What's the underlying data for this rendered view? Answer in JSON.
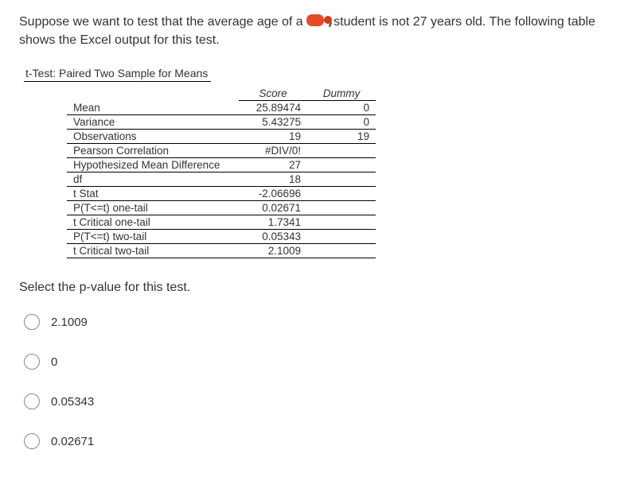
{
  "question": {
    "part1": "Suppose we want to test that the average age of a",
    "part2": "student is not 27 years old. The following table shows the Excel output for this test."
  },
  "table_title": "t-Test: Paired Two Sample for Means",
  "headers": {
    "col1": "Score",
    "col2": "Dummy"
  },
  "rows": [
    {
      "label": "Mean",
      "score": "25.89474",
      "dummy": "0"
    },
    {
      "label": "Variance",
      "score": "5.43275",
      "dummy": "0"
    },
    {
      "label": "Observations",
      "score": "19",
      "dummy": "19"
    },
    {
      "label": "Pearson Correlation",
      "score": "#DIV/0!",
      "dummy": ""
    },
    {
      "label": "Hypothesized Mean Difference",
      "score": "27",
      "dummy": ""
    },
    {
      "label": "df",
      "score": "18",
      "dummy": ""
    },
    {
      "label": "t Stat",
      "score": "-2.06696",
      "dummy": ""
    },
    {
      "label": "P(T<=t) one-tail",
      "score": "0.02671",
      "dummy": ""
    },
    {
      "label": "t Critical one-tail",
      "score": "1.7341",
      "dummy": ""
    },
    {
      "label": "P(T<=t) two-tail",
      "score": "0.05343",
      "dummy": ""
    },
    {
      "label": "t Critical two-tail",
      "score": "2.1009",
      "dummy": ""
    }
  ],
  "prompt": "Select the p-value for this test.",
  "options": [
    "2.1009",
    "0",
    "0.05343",
    "0.02671"
  ]
}
